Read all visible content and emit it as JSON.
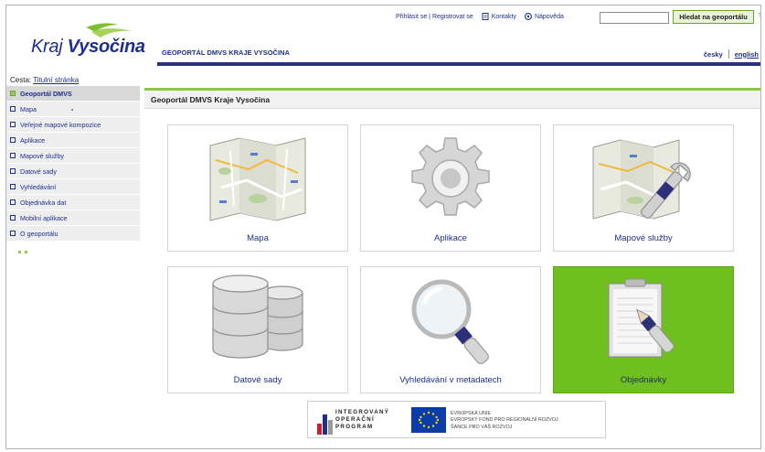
{
  "header": {
    "login_link": "Přihlásit se | Registrovat se",
    "contacts_link": "Kontakty",
    "help_link": "Nápověda",
    "search_placeholder": "",
    "search_button": "Hledat na geoportálu",
    "help_mark": "?",
    "logo_thin": "Kraj ",
    "logo_bold": "Vysočina",
    "site_title": "GEOPORTÁL DMVS KRAJE VYSOČINA",
    "lang_cz": "česky",
    "lang_en": "english"
  },
  "breadcrumb": {
    "prefix": "Cesta: ",
    "link": "Titulní stránka"
  },
  "sidebar": {
    "items": [
      {
        "label": "Geoportál DMVS"
      },
      {
        "label": "Mapa"
      },
      {
        "label": "Veřejné mapové kompozice"
      },
      {
        "label": "Aplikace"
      },
      {
        "label": "Mapové služby"
      },
      {
        "label": "Datové sady"
      },
      {
        "label": "Vyhledávání"
      },
      {
        "label": "Objednávka dat"
      },
      {
        "label": "Mobilní aplikace"
      },
      {
        "label": "O geoportálu"
      }
    ]
  },
  "main": {
    "heading": "Geoportál DMVS Kraje Vysočina",
    "tiles": [
      {
        "label": "Mapa",
        "icon": "map-icon"
      },
      {
        "label": "Aplikace",
        "icon": "gear-icon"
      },
      {
        "label": "Mapové služby",
        "icon": "map-wrench-icon"
      },
      {
        "label": "Datové sady",
        "icon": "database-icon"
      },
      {
        "label": "Vyhledávání v metadatech",
        "icon": "magnifier-icon"
      },
      {
        "label": "Objednávky",
        "icon": "clipboard-pen-icon"
      }
    ]
  },
  "footer": {
    "iop_line1": "INTEGROVANÝ",
    "iop_line2": "OPERAČNÍ",
    "iop_line3": "PROGRAM",
    "eu_line1": "EVROPSKÁ UNIE",
    "eu_line2": "EVROPSKÝ FOND PRO REGIONÁLNÍ ROZVOJ",
    "eu_line3": "ŠANCE PRO VÁŠ ROZVOJ"
  },
  "colors": {
    "brand_blue": "#1f2f8a",
    "accent_green": "#8dc63f",
    "tile_highlight": "#6fc01f"
  }
}
